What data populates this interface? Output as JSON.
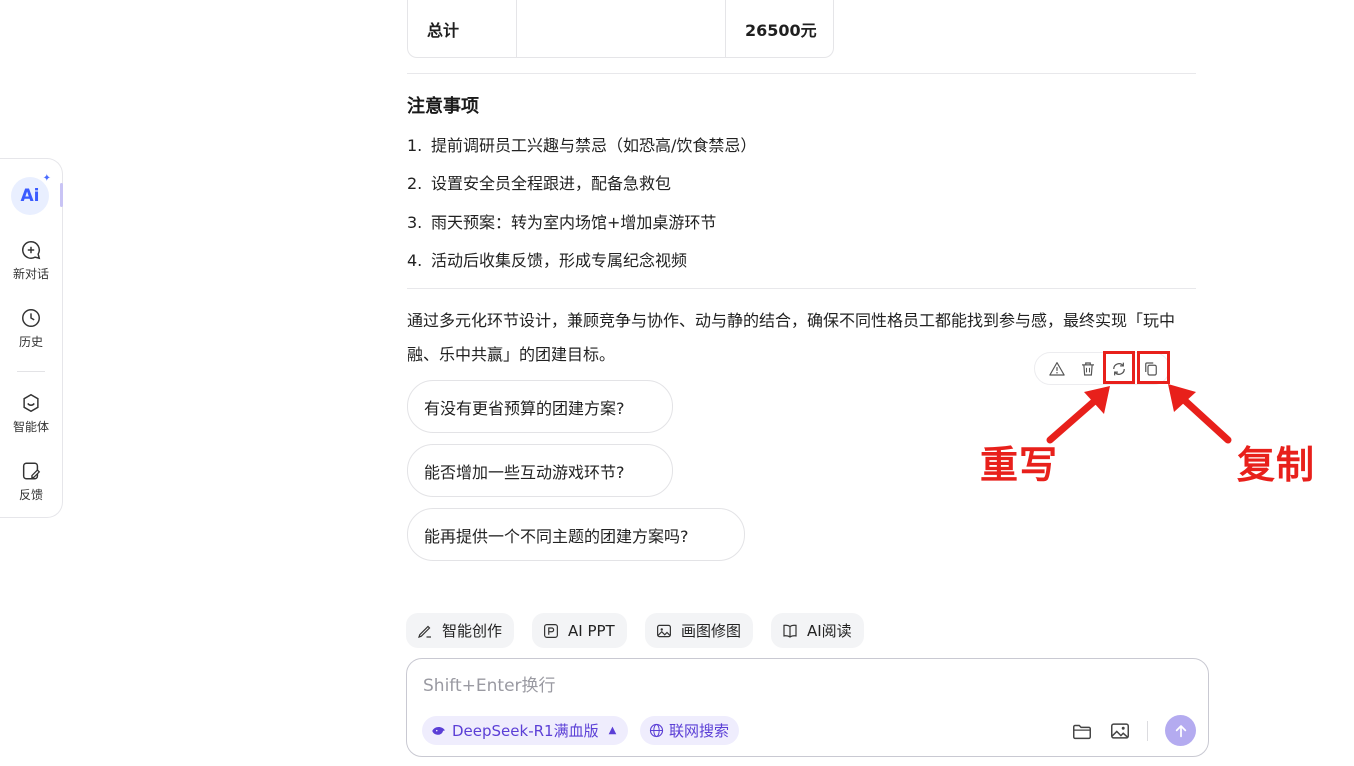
{
  "sidebar": {
    "logo_text": "Ai",
    "items": [
      {
        "label": "新对话",
        "icon": "new-chat-icon"
      },
      {
        "label": "历史",
        "icon": "clock-icon"
      },
      {
        "label": "智能体",
        "icon": "agent-icon"
      },
      {
        "label": "反馈",
        "icon": "feedback-icon"
      }
    ]
  },
  "table": {
    "row_label": "总计",
    "row_middle": "",
    "row_value": "26500元"
  },
  "notes": {
    "title": "注意事项",
    "items": [
      {
        "num": "1.",
        "text": "提前调研员工兴趣与禁忌（如恐高/饮食禁忌）"
      },
      {
        "num": "2.",
        "text": "设置安全员全程跟进，配备急救包"
      },
      {
        "num": "3.",
        "text": "雨天预案：转为室内场馆+增加桌游环节"
      },
      {
        "num": "4.",
        "text": "活动后收集反馈，形成专属纪念视频"
      }
    ]
  },
  "summary": "通过多元化环节设计，兼顾竞争与协作、动与静的结合，确保不同性格员工都能找到参与感，最终实现「玩中融、乐中共赢」的团建目标。",
  "message_actions": [
    "report-icon",
    "delete-icon",
    "regenerate-icon",
    "copy-icon"
  ],
  "annotations": {
    "rewrite": "重写",
    "copy": "复制",
    "color": "#e8201b"
  },
  "suggestions": [
    "有没有更省预算的团建方案?",
    "能否增加一些互动游戏环节?",
    "能再提供一个不同主题的团建方案吗?"
  ],
  "tools": [
    "智能创作",
    "AI PPT",
    "画图修图",
    "AI阅读"
  ],
  "input": {
    "placeholder": "Shift+Enter换行",
    "model": "DeepSeek-R1满血版",
    "web_search": "联网搜索"
  },
  "colors": {
    "accent": "#5b3fd6",
    "send_button": "#b4abf0"
  }
}
